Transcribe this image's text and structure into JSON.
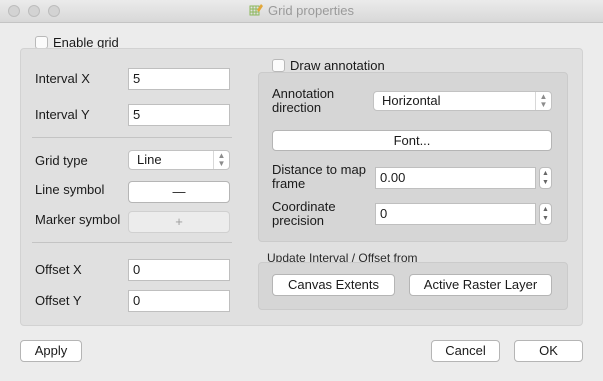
{
  "window": {
    "title": "Grid properties"
  },
  "enable_grid": {
    "label": "Enable grid",
    "checked": false
  },
  "interval": {
    "x_label": "Interval X",
    "x_value": "5",
    "y_label": "Interval Y",
    "y_value": "5"
  },
  "grid_type": {
    "label": "Grid type",
    "value": "Line"
  },
  "line_symbol": {
    "label": "Line symbol",
    "button": "—"
  },
  "marker_symbol": {
    "label": "Marker symbol",
    "button": "+"
  },
  "offset": {
    "x_label": "Offset X",
    "x_value": "0",
    "y_label": "Offset Y",
    "y_value": "0"
  },
  "annotation": {
    "draw_label": "Draw annotation",
    "draw_checked": false,
    "direction_label": "Annotation direction",
    "direction_value": "Horizontal",
    "font_button": "Font...",
    "distance_label": "Distance to map frame",
    "distance_value": "0.00",
    "precision_label": "Coordinate precision",
    "precision_value": "0"
  },
  "update_group": {
    "title": "Update Interval / Offset from",
    "canvas_button": "Canvas Extents",
    "raster_button": "Active Raster Layer"
  },
  "footer": {
    "apply": "Apply",
    "cancel": "Cancel",
    "ok": "OK"
  }
}
